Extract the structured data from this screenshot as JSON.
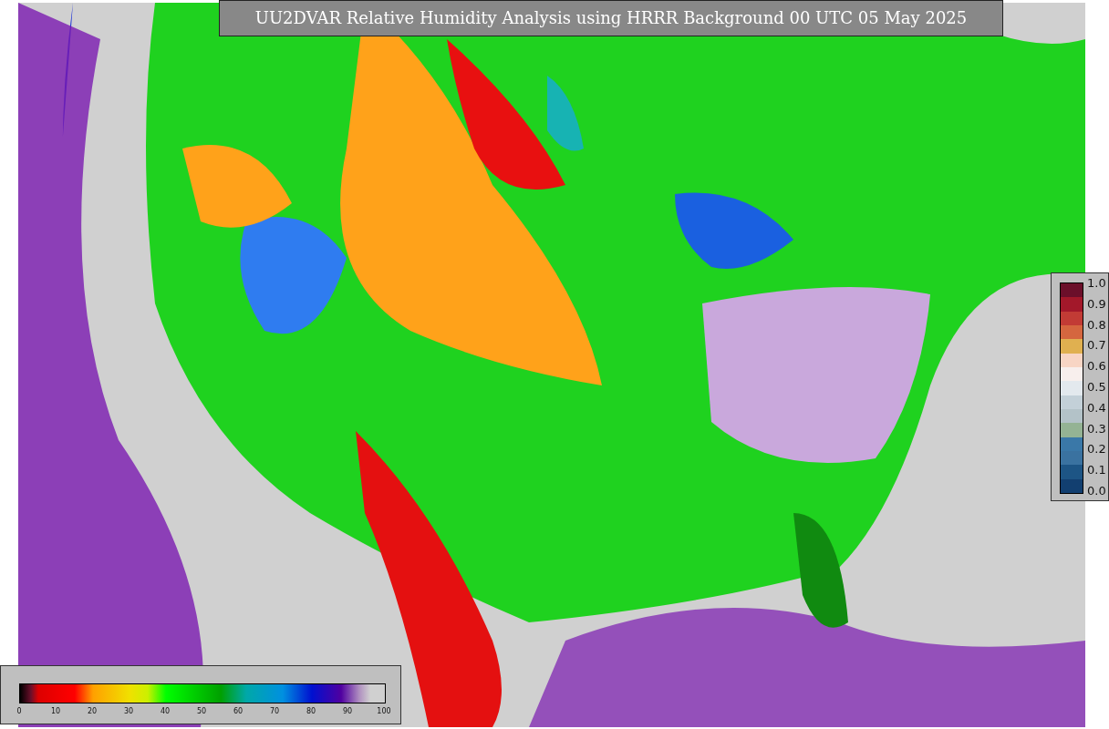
{
  "map": {
    "title": "UU2DVAR Relative Humidity Analysis using HRRR Background 00 UTC 05 May 2025"
  },
  "side_colorbar": {
    "ticks": [
      "1.0",
      "0.9",
      "0.8",
      "0.7",
      "0.6",
      "0.5",
      "0.4",
      "0.3",
      "0.2",
      "0.1",
      "0.0"
    ]
  },
  "bottom_colorbar": {
    "ticks": [
      "0",
      "10",
      "20",
      "30",
      "40",
      "50",
      "60",
      "70",
      "80",
      "90",
      "100"
    ]
  }
}
